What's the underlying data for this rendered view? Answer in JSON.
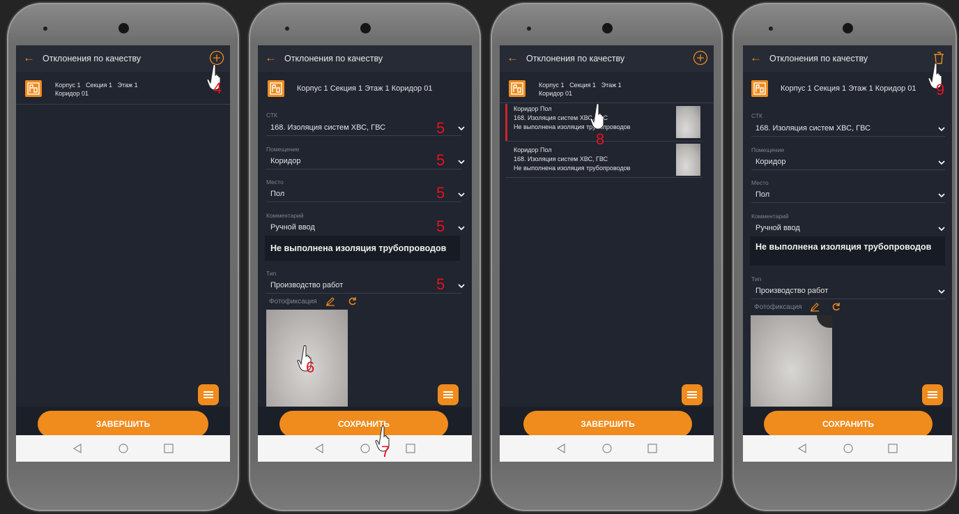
{
  "colors": {
    "accent": "#f08b1d",
    "screen_bg": "#202530",
    "appbar_bg": "#262b35",
    "step_number": "#e8101e",
    "selected_marker": "#d0222a"
  },
  "app": {
    "title": "Отклонения по качеству",
    "back_icon": "arrow-left-icon"
  },
  "screens": {
    "s1": {
      "action_icon": "plus-circle-icon",
      "location": {
        "korpus": "Корпус 1",
        "section": "Секция 1",
        "floor": "Этаж 1",
        "room": "Коридор 01"
      },
      "fab_icon": "menu-icon",
      "bottom_button": "ЗАВЕРШИТЬ",
      "step": "4"
    },
    "s2": {
      "location": "Корпус 1 Секция 1 Этаж 1 Коридор 01",
      "fields": [
        {
          "label": "СТК",
          "value": "168. Изоляция систем ХВС, ГВС",
          "step": "5"
        },
        {
          "label": "Помещение",
          "value": "Коридор",
          "step": "5"
        },
        {
          "label": "Место",
          "value": "Пол",
          "step": "5"
        },
        {
          "label": "Комментарий",
          "value": "Ручной ввод",
          "step": "5"
        }
      ],
      "comment_text": "Не выполнена изоляция трубопроводов",
      "type": {
        "label": "Тип",
        "value": "Производство работ",
        "step": "5"
      },
      "photo_label": "Фотофиксация",
      "photo_step": "6",
      "bottom_button": "СОХРАНИТЬ",
      "save_step": "7"
    },
    "s3": {
      "action_icon": "plus-circle-icon",
      "location": {
        "korpus": "Корпус 1",
        "section": "Секция 1",
        "floor": "Этаж 1",
        "room": "Коридор 01"
      },
      "items": [
        {
          "line1": "Коридор Пол",
          "line2": "168. Изоляция систем ХВС, ГВС",
          "line3": "Не выполнена изоляция трубопроводов",
          "selected": true
        },
        {
          "line1": "Коридор Пол",
          "line2": "168. Изоляция систем ХВС, ГВС",
          "line3": "Не выполнена изоляция трубопроводов",
          "selected": false
        }
      ],
      "item_step": "8",
      "bottom_button": "ЗАВЕРШИТЬ"
    },
    "s4": {
      "action_icon": "trash-icon",
      "location": "Корпус 1 Секция 1 Этаж 1 Коридор 01",
      "fields": [
        {
          "label": "СТК",
          "value": "168. Изоляция систем ХВС, ГВС"
        },
        {
          "label": "Помещение",
          "value": "Коридор"
        },
        {
          "label": "Место",
          "value": "Пол"
        },
        {
          "label": "Комментарий",
          "value": "Ручной ввод"
        }
      ],
      "comment_text": "Не выполнена изоляция трубопроводов",
      "type": {
        "label": "Тип",
        "value": "Производство работ"
      },
      "photo_label": "Фотофиксация",
      "bottom_button": "СОХРАНИТЬ",
      "delete_step": "9"
    }
  },
  "navbar": {
    "back": "nav-back-icon",
    "home": "nav-home-icon",
    "recent": "nav-recents-icon"
  }
}
